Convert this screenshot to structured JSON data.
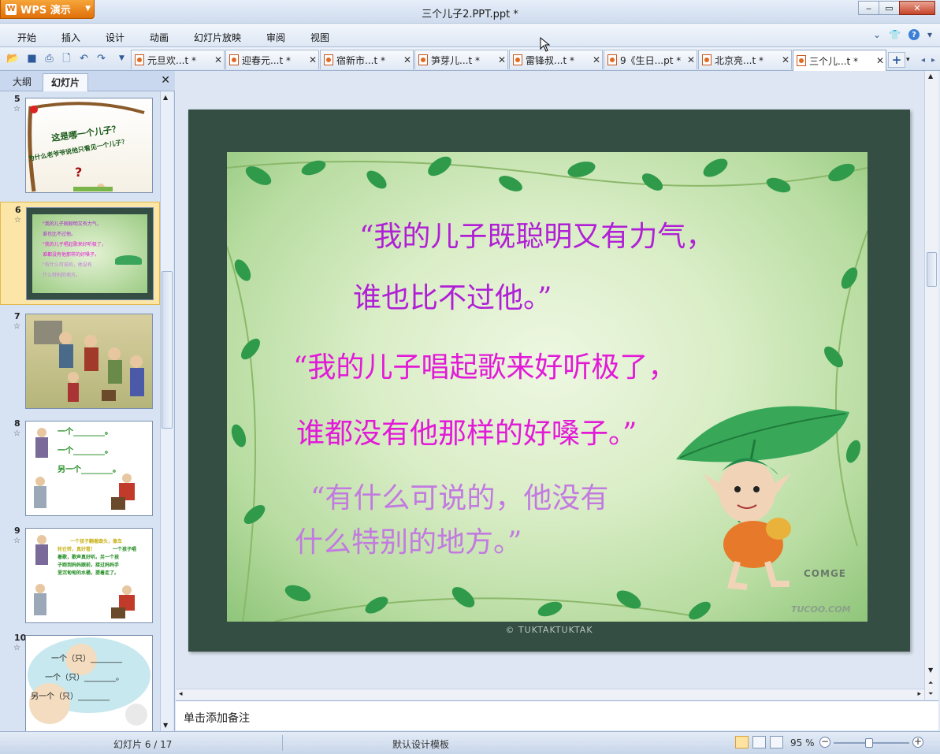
{
  "app": {
    "name": "WPS 演示",
    "title": "三个儿子2.PPT.ppt *"
  },
  "menu": [
    "开始",
    "插入",
    "设计",
    "动画",
    "幻灯片放映",
    "审阅",
    "视图"
  ],
  "tabs": [
    {
      "label": "元旦欢...t *"
    },
    {
      "label": "迎春元...t *"
    },
    {
      "label": "宿新市...t *"
    },
    {
      "label": "笋芽儿...t *"
    },
    {
      "label": "雷锋叔...t *"
    },
    {
      "label": "9《生日...pt *"
    },
    {
      "label": "北京亮...t *"
    },
    {
      "label": "三个儿...t *"
    }
  ],
  "panel": {
    "tab_outline": "大纲",
    "tab_slides": "幻灯片"
  },
  "thumbnails": [
    {
      "num": "5",
      "star": "☆",
      "lines": [
        "这是哪一个儿子？",
        "为什么老爷爷说他只看见一个儿子？",
        "?"
      ]
    },
    {
      "num": "6",
      "star": "☆",
      "lines": [
        "\"我的儿子既聪明又有力气，",
        "谁也比不过他。",
        "\"我的儿子唱起歌来好听极了，",
        "谁都没有他那样的好嗓子。",
        "\"有什么可说的，他没有",
        "什么特别的地方。"
      ]
    },
    {
      "num": "7",
      "star": "☆",
      "lines": []
    },
    {
      "num": "8",
      "star": "☆",
      "lines": [
        "一个________。",
        "一个________。",
        "另一个________。"
      ]
    },
    {
      "num": "9",
      "star": "☆",
      "lines": [
        "一个孩子翻着跟头，像车",
        "轮在转，真好看！",
        "一个孩子唱",
        "着歌，歌声真好听。另一个孩",
        "子跑到妈妈跟前，接过妈妈手",
        "里沉甸甸的水桶，提着走了。"
      ]
    },
    {
      "num": "10",
      "star": "☆",
      "lines": [
        "一个（只）________",
        "一个（只）________。",
        "另一个（只）________"
      ]
    }
  ],
  "slide": {
    "line1": "“我的儿子既聪明又有力气，",
    "line2": "谁也比不过他。”",
    "line3": "“我的儿子唱起歌来好听极了，",
    "line4": "谁都没有他那样的好嗓子。”",
    "line5": "“有什么可说的，他没有",
    "line6": "什么特别的地方。”",
    "watermark1": "COMGE",
    "watermark2": "TUCOO.COM",
    "credit": "© TUKTAKTUKTAK"
  },
  "colors": {
    "line12": "#b01fd6",
    "line34": "#e21ad8",
    "line56": "#c27ae0"
  },
  "notes_placeholder": "单击添加备注",
  "status": {
    "slide_counter": "幻灯片 6 / 17",
    "template": "默认设计模板",
    "zoom": "95 %"
  }
}
